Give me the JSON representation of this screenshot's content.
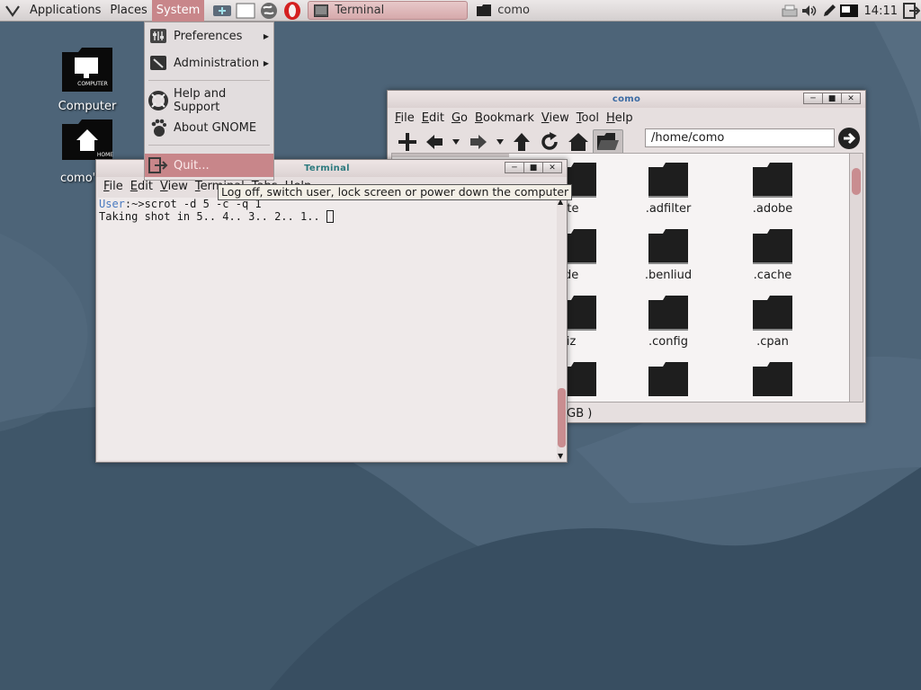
{
  "panel": {
    "menus": {
      "applications": "Applications",
      "places": "Places",
      "system": "System"
    },
    "taskbar": [
      {
        "label": "Terminal",
        "icon": "terminal-icon"
      },
      {
        "label": "como",
        "icon": "folder-icon"
      }
    ],
    "clock": "14:11"
  },
  "desktop": {
    "icons": [
      {
        "label": "Computer",
        "badge": "COMPUTER"
      },
      {
        "label": "como's",
        "badge": "HOME"
      }
    ]
  },
  "system_menu": {
    "items": [
      {
        "label": "Preferences",
        "has_submenu": true
      },
      {
        "label": "Administration",
        "has_submenu": true
      },
      {
        "label": "Help and Support"
      },
      {
        "label": "About GNOME"
      },
      {
        "label": "Quit..."
      }
    ],
    "highlighted": "Quit..."
  },
  "tooltip": "Log off, switch user, lock screen or power down the computer",
  "file_manager": {
    "title": "como",
    "menus": [
      "File",
      "Edit",
      "Go",
      "Bookmark",
      "View",
      "Tool",
      "Help"
    ],
    "location": "/home/como",
    "items": [
      {
        "name": "uite"
      },
      {
        "name": ".adfilter"
      },
      {
        "name": ".adobe"
      },
      {
        "name": "ude"
      },
      {
        "name": ".benliud"
      },
      {
        "name": ".cache"
      },
      {
        "name": "piz"
      },
      {
        "name": ".config"
      },
      {
        "name": ".cpan"
      },
      {
        "name": ""
      },
      {
        "name": ""
      },
      {
        "name": ""
      }
    ],
    "status": "e space: 918.7 MB (Total: 7.8 GB )"
  },
  "terminal": {
    "title": "Terminal",
    "menus": [
      "File",
      "Edit",
      "View",
      "Terminal",
      "Tabs",
      "Help"
    ],
    "prompt_user": "User",
    "prompt_rest": ":~>scrot -d 5 -c -q 1",
    "output": "Taking shot in 5.. 4.. 3.. 2.. 1.. "
  },
  "colors": {
    "accent": "#c8868a",
    "desktop": "#4d6478",
    "title_blue": "#3a6aa3",
    "title_teal": "#2d7a7e"
  }
}
